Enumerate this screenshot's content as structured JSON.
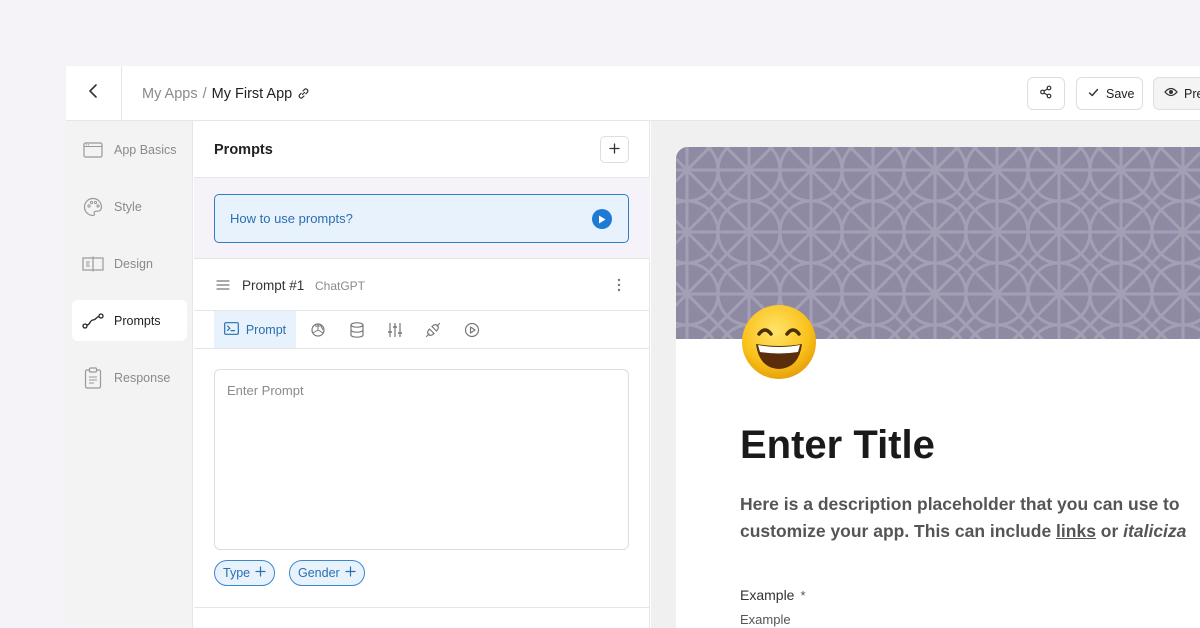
{
  "topbar": {
    "breadcrumb_parent": "My Apps",
    "breadcrumb_sep": "/",
    "breadcrumb_current": "My First App",
    "save_label": "Save",
    "preview_label": "Pre"
  },
  "sidebar": {
    "items": [
      {
        "label": "App Basics",
        "icon": "window-icon"
      },
      {
        "label": "Style",
        "icon": "palette-icon"
      },
      {
        "label": "Design",
        "icon": "layout-icon"
      },
      {
        "label": "Prompts",
        "icon": "flow-icon",
        "active": true
      },
      {
        "label": "Response",
        "icon": "clipboard-icon"
      }
    ]
  },
  "panel": {
    "title": "Prompts",
    "howto_label": "How to use prompts?",
    "prompt": {
      "name": "Prompt #1",
      "model": "ChatGPT",
      "active_tab_label": "Prompt",
      "tab_icons": [
        "openai-icon",
        "database-icon",
        "sliders-icon",
        "plug-icon",
        "play-icon"
      ],
      "input_placeholder": "Enter Prompt",
      "input_value": ""
    },
    "chips": [
      {
        "label": "Type"
      },
      {
        "label": "Gender"
      }
    ]
  },
  "preview": {
    "title": "Enter Title",
    "desc_line1": "Here is a description placeholder that you can use to",
    "desc_line2_pre": "customize your app. This can include ",
    "desc_link": "links",
    "desc_mid": " or ",
    "desc_italic": "italiciza",
    "field_label": "Example",
    "field_required": "*",
    "field_sub": "Example"
  },
  "colors": {
    "accent": "#2a6fb0",
    "accent_bg": "#e8f2fc",
    "banner": "#8e8aa4",
    "page_bg": "#f5f2f8"
  }
}
